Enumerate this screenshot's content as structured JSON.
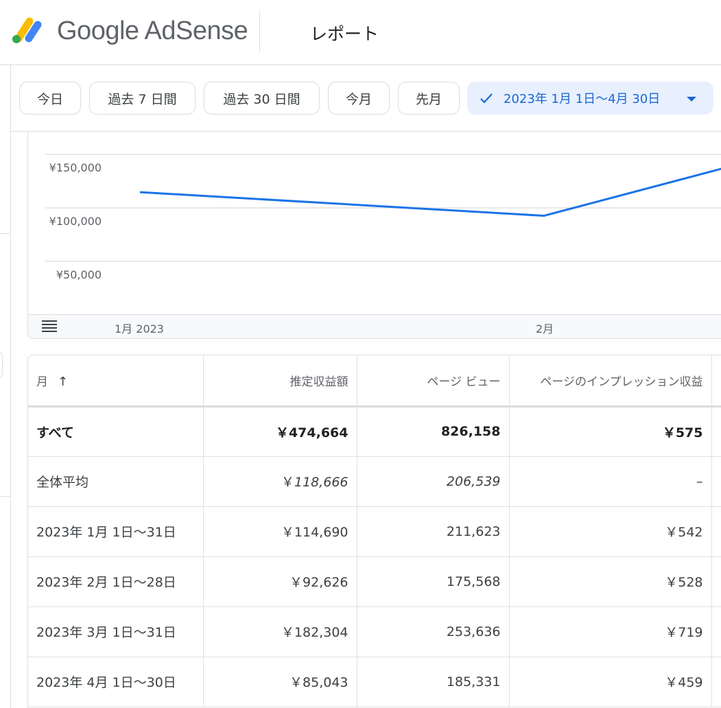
{
  "header": {
    "brand": "Google AdSense",
    "page_title": "レポート"
  },
  "filters": {
    "chips": [
      "今日",
      "過去 7 日間",
      "過去 30 日間",
      "今月",
      "先月"
    ],
    "active_range": "2023年 1月 1日～4月 30日"
  },
  "chart_data": {
    "type": "line",
    "y_ticks": [
      "¥150,000",
      "¥100,000",
      "¥50,000"
    ],
    "x_ticks": [
      "1月 2023",
      "2月"
    ],
    "series": [
      {
        "x": [
          "2023-01",
          "2023-02",
          "2023-03"
        ],
        "values": [
          114690,
          92626,
          182304
        ]
      }
    ],
    "ylim": [
      0,
      150000
    ],
    "grid": true,
    "color": "#1a73e8"
  },
  "table": {
    "headers": [
      "月",
      "推定収益額",
      "ページ ビュー",
      "ページのインプレッション収益"
    ],
    "total": {
      "label": "すべて",
      "revenue": "￥474,664",
      "pageviews": "826,158",
      "rpm": "￥575"
    },
    "average": {
      "label": "全体平均",
      "currency": "￥",
      "revenue": "118,666",
      "pageviews": "206,539",
      "rpm": "–"
    },
    "rows": [
      {
        "label": "2023年 1月 1日～31日",
        "revenue": "￥114,690",
        "pageviews": "211,623",
        "rpm": "￥542"
      },
      {
        "label": "2023年 2月 1日～28日",
        "revenue": "￥92,626",
        "pageviews": "175,568",
        "rpm": "￥528"
      },
      {
        "label": "2023年 3月 1日～31日",
        "revenue": "￥182,304",
        "pageviews": "253,636",
        "rpm": "￥719"
      },
      {
        "label": "2023年 4月 1日～30日",
        "revenue": "￥85,043",
        "pageviews": "185,331",
        "rpm": "￥459"
      }
    ]
  }
}
